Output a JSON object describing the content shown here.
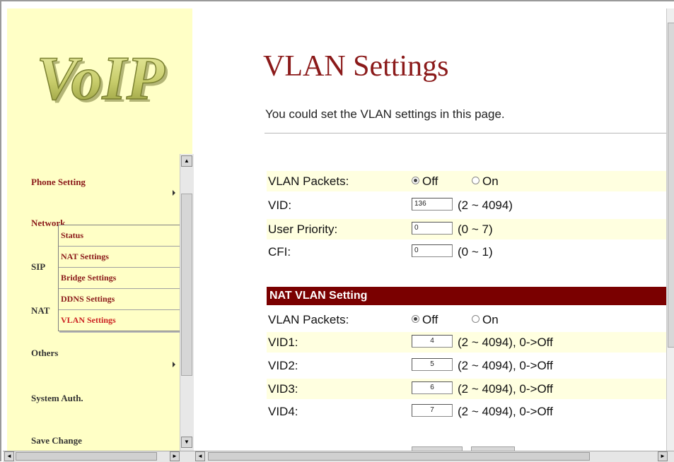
{
  "logo_text": "VoIP",
  "nav": {
    "items": [
      {
        "label": "Phone Setting"
      },
      {
        "label": "Network"
      },
      {
        "label": "SIP"
      },
      {
        "label": "NAT"
      },
      {
        "label": "Others"
      },
      {
        "label": "System Auth."
      },
      {
        "label": "Save Change"
      }
    ],
    "submenu": [
      {
        "label": "Status"
      },
      {
        "label": "NAT Settings"
      },
      {
        "label": "Bridge Settings"
      },
      {
        "label": "DDNS Settings"
      },
      {
        "label": "VLAN Settings"
      }
    ]
  },
  "page": {
    "title": "VLAN Settings",
    "subtitle": "You could set the VLAN settings in this page."
  },
  "vlan": {
    "packets_label": "VLAN Packets:",
    "off_label": "Off",
    "on_label": "On",
    "selected": "Off",
    "vid_label": "VID:",
    "vid_value": "136",
    "vid_range": "(2 ~ 4094)",
    "priority_label": "User Priority:",
    "priority_value": "0",
    "priority_range": "(0 ~ 7)",
    "cfi_label": "CFI:",
    "cfi_value": "0",
    "cfi_range": "(0 ~ 1)"
  },
  "nat_vlan": {
    "heading": "NAT VLAN Setting",
    "packets_label": "VLAN Packets:",
    "off_label": "Off",
    "on_label": "On",
    "selected": "Off",
    "rows": [
      {
        "label": "VID1:",
        "value": "4",
        "range": "(2 ~ 4094), 0->Off"
      },
      {
        "label": "VID2:",
        "value": "5",
        "range": "(2 ~ 4094), 0->Off"
      },
      {
        "label": "VID3:",
        "value": "6",
        "range": "(2 ~ 4094), 0->Off"
      },
      {
        "label": "VID4:",
        "value": "7",
        "range": "(2 ~ 4094), 0->Off"
      }
    ]
  },
  "colors": {
    "nav_bg": "#ffffc6",
    "accent": "#8b1a1a",
    "section_bg": "#7a0000",
    "row_bg": "#ffffe0"
  }
}
